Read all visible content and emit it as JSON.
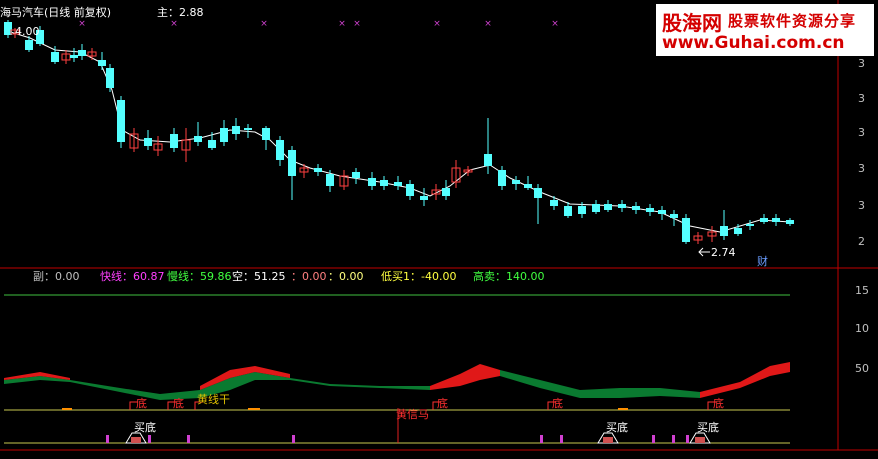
{
  "header": {
    "title": "海马汽车(日线 前复权)",
    "main_label": "主：2.88",
    "top_value": "4.00"
  },
  "watermark": {
    "brand": "股海网",
    "tagline": "股票软件资源分享",
    "url": "www.Guhai.com.cn"
  },
  "price_panel": {
    "low_label": "2.74",
    "fin_marker": "财",
    "axis_digits": [
      "3",
      "3",
      "3",
      "3",
      "3",
      "2"
    ],
    "colors": {
      "up": "#ff4040",
      "down": "#54ffff",
      "ma": "#ffffff",
      "cross": "#d040d0"
    }
  },
  "indicator_panel": {
    "legend": [
      {
        "label": "副：0.00",
        "color": "#c0c0c0"
      },
      {
        "label": "快线：60.87",
        "color": "#ff40ff"
      },
      {
        "label": "慢线：59.86",
        "color": "#40ff40"
      },
      {
        "label": "空：51.25",
        "color": "#ffffff"
      },
      {
        "label": "：0.00",
        "color": "#ff8080"
      },
      {
        "label": "：0.00",
        "color": "#ffff80"
      },
      {
        "label": "低买1：-40.00",
        "color": "#ffff40"
      },
      {
        "label": "高卖：140.00",
        "color": "#40ff40"
      }
    ],
    "axis_labels": [
      "15",
      "10",
      "50"
    ],
    "signals": {
      "di": "底",
      "mai_di": "买底",
      "huang_xian_gan": "黄线干",
      "huang_xin_ma": "黄信马"
    },
    "colors": {
      "red_band": "#e01818",
      "green_band": "#0a7a30",
      "hline": "#c8c850",
      "topline": "#3fbf3f",
      "bar": "#d040d0"
    }
  }
}
